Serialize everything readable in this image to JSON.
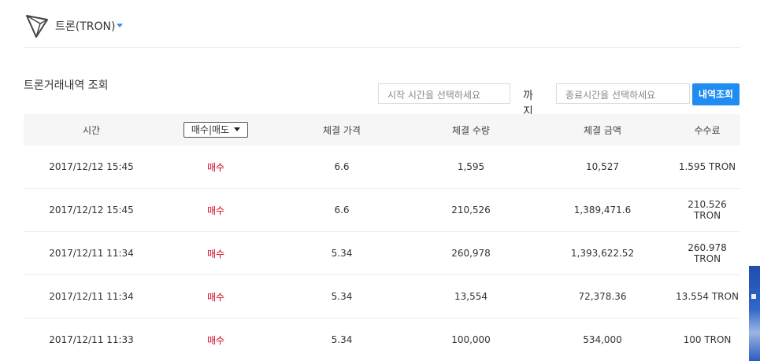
{
  "header": {
    "coin_name": "트론(TRON)"
  },
  "section": {
    "title": "트론거래내역 조회"
  },
  "filters": {
    "start_placeholder": "시작 시간을 선택하세요",
    "until_label": "까지",
    "end_placeholder": "종료시간을 선택하세요",
    "search_label": "내역조회"
  },
  "table": {
    "headers": {
      "time": "시간",
      "type_select": "매수|매도",
      "price": "체결 가격",
      "quantity": "체결 수량",
      "amount": "체결 금액",
      "fee": "수수료"
    },
    "rows": [
      {
        "time": "2017/12/12 15:45",
        "side": "매수",
        "price": "6.6",
        "quantity": "1,595",
        "amount": "10,527",
        "fee": "1.595 TRON"
      },
      {
        "time": "2017/12/12 15:45",
        "side": "매수",
        "price": "6.6",
        "quantity": "210,526",
        "amount": "1,389,471.6",
        "fee": "210.526 TRON"
      },
      {
        "time": "2017/12/11 11:34",
        "side": "매수",
        "price": "5.34",
        "quantity": "260,978",
        "amount": "1,393,622.52",
        "fee": "260.978 TRON"
      },
      {
        "time": "2017/12/11 11:34",
        "side": "매수",
        "price": "5.34",
        "quantity": "13,554",
        "amount": "72,378.36",
        "fee": "13.554 TRON"
      },
      {
        "time": "2017/12/11 11:33",
        "side": "매수",
        "price": "5.34",
        "quantity": "100,000",
        "amount": "534,000",
        "fee": "100 TRON"
      }
    ]
  },
  "colors": {
    "accent": "#1e8cf0",
    "buy": "#d0021b"
  },
  "icons": {
    "logo": "tron-logo-icon",
    "dropdown": "caret-down-icon"
  }
}
